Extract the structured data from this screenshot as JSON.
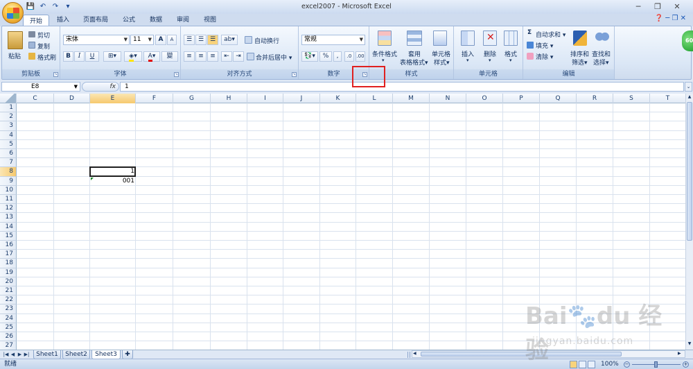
{
  "window": {
    "title": "excel2007 - Microsoft Excel",
    "min": "─",
    "restore": "❐",
    "close": "✕"
  },
  "qat": {
    "save": "💾",
    "undo": "↶",
    "redo": "↷",
    "customize": "▾"
  },
  "tabs": [
    "开始",
    "插入",
    "页面布局",
    "公式",
    "数据",
    "审阅",
    "视图"
  ],
  "ribbon": {
    "clipboard": {
      "label": "剪贴板",
      "paste": "粘贴",
      "cut": "剪切",
      "copy": "复制",
      "format_painter": "格式刷"
    },
    "font": {
      "label": "字体",
      "font_name": "宋体",
      "font_size": "11",
      "grow": "A",
      "shrink": "A",
      "bold": "B",
      "italic": "I",
      "underline": "U",
      "wen": "變"
    },
    "alignment": {
      "label": "对齐方式",
      "wrap_text": "自动换行",
      "merge_center": "合并后居中"
    },
    "number": {
      "label": "数字",
      "format": "常规",
      "percent": "%"
    },
    "styles": {
      "label": "样式",
      "conditional": "条件格式",
      "table_format_1": "套用",
      "table_format_2": "表格格式",
      "cell_style_1": "单元格",
      "cell_style_2": "样式"
    },
    "cells": {
      "label": "单元格",
      "insert": "插入",
      "delete": "删除",
      "format": "格式"
    },
    "editing": {
      "label": "编辑",
      "autosum": "自动求和",
      "fill": "填充",
      "clear": "清除",
      "sort_1": "排序和",
      "sort_2": "筛选",
      "find_1": "查找和",
      "find_2": "选择",
      "sigma": "Σ"
    }
  },
  "formula_bar": {
    "name_box": "E8",
    "fx": "fx",
    "value": "1"
  },
  "columns": [
    "C",
    "D",
    "E",
    "F",
    "G",
    "H",
    "I",
    "J",
    "K",
    "L",
    "M",
    "N",
    "O",
    "P",
    "Q",
    "R",
    "S",
    "T"
  ],
  "rows": [
    "1",
    "2",
    "3",
    "4",
    "5",
    "6",
    "7",
    "8",
    "9",
    "10",
    "11",
    "12",
    "13",
    "14",
    "15",
    "16",
    "17",
    "18",
    "19",
    "20",
    "21",
    "22",
    "23",
    "24",
    "25",
    "26",
    "27"
  ],
  "cells": {
    "E8": "1",
    "E9": "001"
  },
  "sheets": [
    "Sheet1",
    "Sheet2",
    "Sheet3"
  ],
  "status": {
    "ready": "就绪",
    "zoom": "100%"
  },
  "watermark": {
    "brand": "Bai",
    "brand2": "du",
    "cn": "经验",
    "url": "jingyan.baidu.com"
  },
  "badge": "60"
}
